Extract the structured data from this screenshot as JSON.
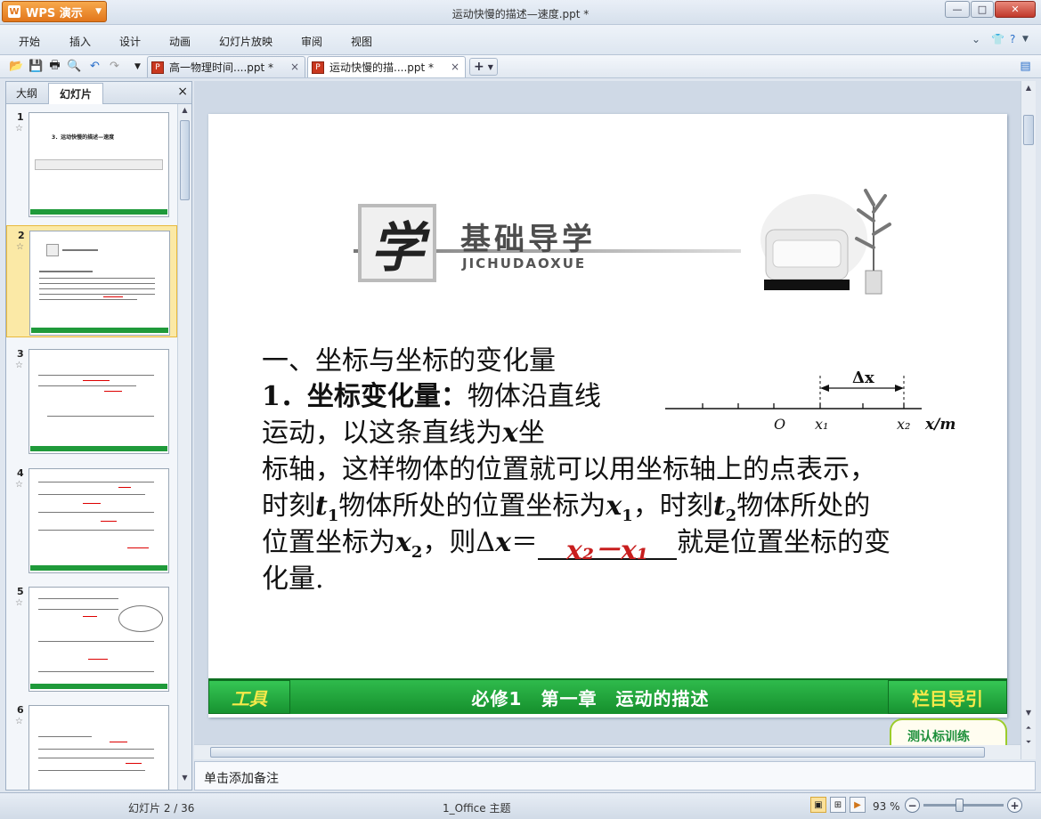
{
  "app": {
    "name": "WPS 演示",
    "logo": "W",
    "document_title": "运动快慢的描述—速度.ppt *"
  },
  "window_controls": {
    "minimize": "—",
    "maximize": "□",
    "close": "✕"
  },
  "menu": {
    "items": [
      "开始",
      "插入",
      "设计",
      "动画",
      "幻灯片放映",
      "审阅",
      "视图"
    ],
    "right_icons": [
      "chevron-down-icon",
      "shirt-icon",
      "help-icon"
    ]
  },
  "toolbar": {
    "quick_icons": [
      "open-folder-icon",
      "save-icon",
      "print-icon",
      "print-preview-icon",
      "undo-icon",
      "redo-icon",
      "dropdown-icon"
    ],
    "tabs": [
      {
        "label": "高一物理时间....ppt *",
        "close": "×",
        "active": false
      },
      {
        "label": "运动快慢的描....ppt *",
        "close": "×",
        "active": true
      }
    ],
    "add_tab": "+"
  },
  "left_panel": {
    "tabs": [
      "大纲",
      "幻灯片"
    ],
    "active_tab": "幻灯片",
    "close": "×",
    "slides": [
      {
        "number": "1",
        "selected": false
      },
      {
        "number": "2",
        "selected": true
      },
      {
        "number": "3",
        "selected": false
      },
      {
        "number": "4",
        "selected": false
      },
      {
        "number": "5",
        "selected": false
      },
      {
        "number": "6",
        "selected": false
      }
    ],
    "slide1_title": "3．运动快慢的描述—速度"
  },
  "slide": {
    "header_char": "学",
    "header_title": "基础导学",
    "header_pinyin": "JICHUDAOXUE",
    "section": "一、坐标与坐标的变化量",
    "item_label": "1．坐标变化量：",
    "item_text": "物体沿直线",
    "line3_a": "运动，以这条直线为",
    "line3_var": "x",
    "line3_b": "坐",
    "line4": "标轴，这样物体的位置就可以用坐标轴上的点表示，",
    "line5_a": "时刻",
    "line5_t1": "t",
    "line5_sub1": "1",
    "line5_b": "物体所处的位置坐标为",
    "line5_x1": "x",
    "line5_sub2": "1",
    "line5_c": "，时刻",
    "line5_t2": "t",
    "line5_sub3": "2",
    "line5_d": "物体所处的",
    "line6_a": "位置坐标为",
    "line6_x2": "x",
    "line6_sub": "2",
    "line6_b": "，则Δ",
    "line6_x": "x",
    "line6_eq": "＝",
    "answer": "x₂－x₁",
    "line6_c": "就是位置坐标的变",
    "line7": "化量.",
    "diagram": {
      "delta": "Δx",
      "origin": "O",
      "x1": "x₁",
      "x2": "x₂",
      "axis": "x/m"
    },
    "footer": {
      "left": "工具",
      "center": "必修1　第一章　运动的描述",
      "right": "栏目导引"
    }
  },
  "teaser": "测认标训练",
  "notes_placeholder": "单击添加备注",
  "status": {
    "slide_info": "幻灯片 2 / 36",
    "theme": "1_Office 主题",
    "zoom": "93 %"
  }
}
